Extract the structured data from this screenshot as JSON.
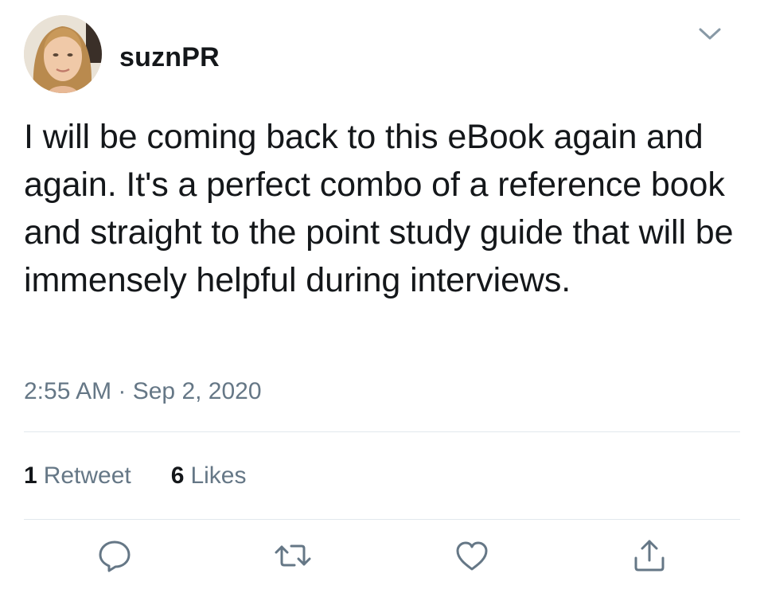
{
  "tweet": {
    "username": "suznPR",
    "text": "I will be coming back to this eBook again and again. It's a perfect combo of a reference book and straight to the point study guide that will be immensely helpful during interviews.",
    "timestamp": "2:55 AM · Sep 2, 2020",
    "retweet_count": "1",
    "retweet_label": "Retweet",
    "like_count": "6",
    "like_label": "Likes"
  },
  "icons": {
    "menu": "chevron-down-icon",
    "reply": "reply-icon",
    "retweet": "retweet-icon",
    "like": "heart-icon",
    "share": "share-icon"
  },
  "colors": {
    "text": "#14171a",
    "secondary": "#657786",
    "divider": "#e1e8ed"
  }
}
